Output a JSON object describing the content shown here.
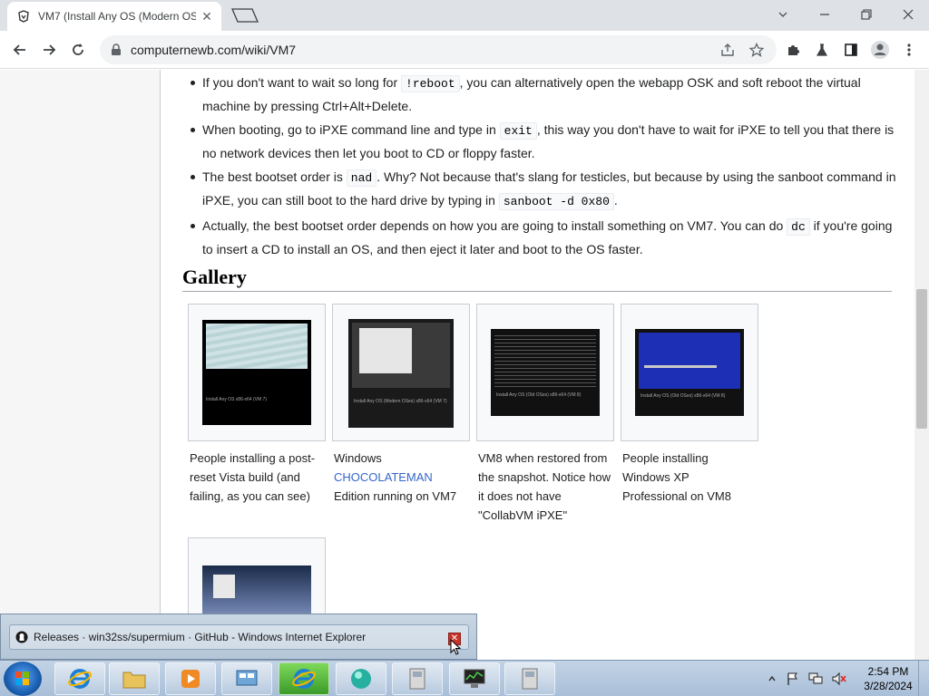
{
  "browser": {
    "tab_title": "VM7 (Install Any OS (Modern OS",
    "url": "computernewb.com/wiki/VM7"
  },
  "notes": [
    {
      "parts": [
        {
          "t": "If you don't want to wait so long for "
        },
        {
          "code": "!reboot"
        },
        {
          "t": ", you can alternatively open the webapp OSK and soft reboot the virtual machine by pressing Ctrl+Alt+Delete."
        }
      ]
    },
    {
      "parts": [
        {
          "t": "When booting, go to iPXE command line and type in "
        },
        {
          "code": "exit"
        },
        {
          "t": ", this way you don't have to wait for iPXE to tell you that there is no network devices then let you boot to CD or floppy faster."
        }
      ]
    },
    {
      "parts": [
        {
          "t": "The best bootset order is "
        },
        {
          "code": "nad"
        },
        {
          "t": ". Why? Not because that's slang for testicles, but because by using the sanboot command in iPXE, you can still boot to the hard drive by typing in "
        },
        {
          "code": "sanboot -d 0x80"
        },
        {
          "t": "."
        }
      ]
    },
    {
      "parts": [
        {
          "t": "Actually, the best bootset order depends on how you are going to install something on VM7. You can do "
        },
        {
          "code": "dc"
        },
        {
          "t": " if you're going to insert a CD to install an OS, and then eject it later and boot to the OS faster."
        }
      ]
    }
  ],
  "gallery": {
    "heading": "Gallery",
    "items": [
      {
        "caption_pre": "People installing a post-reset Vista build (and failing, as you can see)",
        "link": "",
        "caption_post": "",
        "thumb_caption": "Install Any OS x86-x64 (VM 7)"
      },
      {
        "caption_pre": "Windows ",
        "link": "CHOCOLATEMAN",
        "caption_post": " Edition running on VM7",
        "thumb_caption": "Install Any OS (Modern OSes) x86-x64 (VM 7)"
      },
      {
        "caption_pre": "VM8 when restored from the snapshot. Notice how it does not have \"CollabVM iPXE\"",
        "link": "",
        "caption_post": "",
        "thumb_caption": "Install Any OS (Old OSes) x86-x64 (VM 8)"
      },
      {
        "caption_pre": "People installing Windows XP Professional on VM8",
        "link": "",
        "caption_post": "",
        "thumb_caption": "Install Any OS (Old OSes) x86-x64 (VM 8)"
      }
    ]
  },
  "popup": {
    "title": "Releases · win32ss/supermium · GitHub - Windows Internet Explorer"
  },
  "taskbar": {
    "time": "2:54 PM",
    "date": "3/28/2024"
  },
  "colors": {
    "link": "#3366cc",
    "taskbar": "#b4c6d8"
  }
}
